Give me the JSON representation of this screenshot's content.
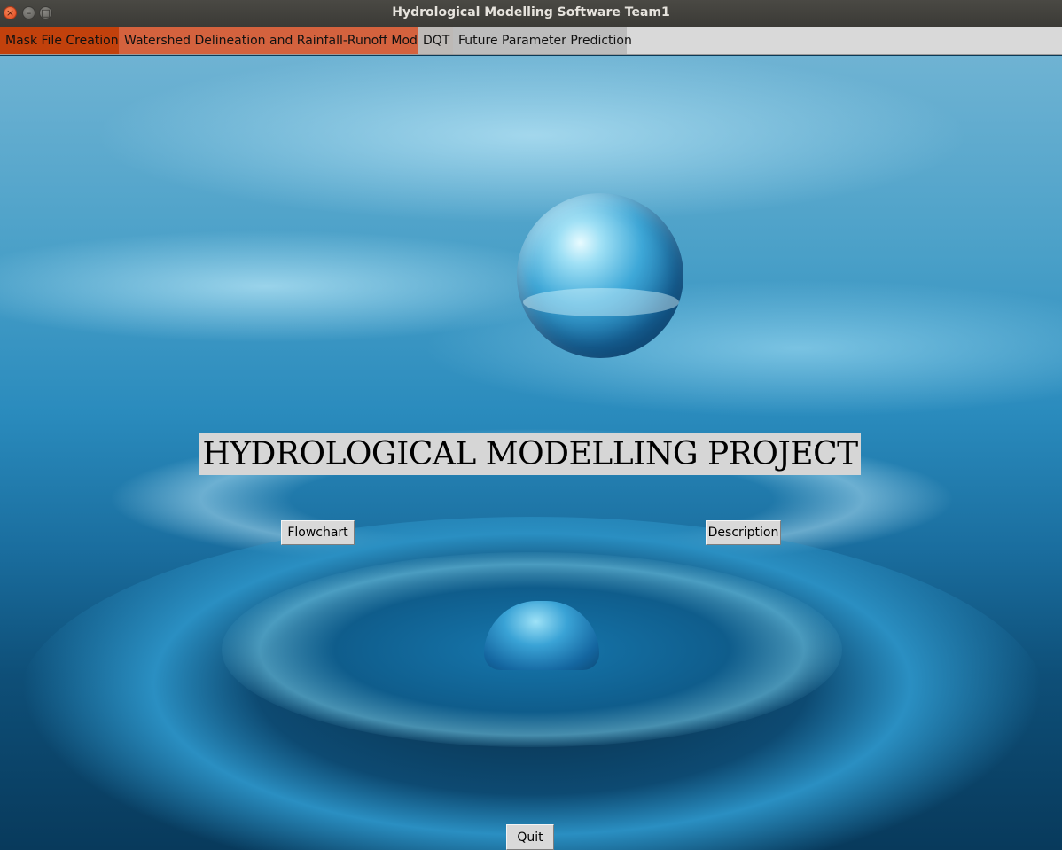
{
  "window": {
    "title": "Hydrological Modelling Software Team1",
    "controls": {
      "close_icon": "close-icon",
      "minimize_icon": "minimize-icon",
      "maximize_icon": "maximize-icon"
    }
  },
  "tabs": [
    {
      "label": "Mask File Creation",
      "color": "#c2410c"
    },
    {
      "label": "Watershed Delineation and Rainfall-Runoff Model",
      "color": "#d4623e"
    },
    {
      "label": "DQT",
      "color": "#bdb9b6"
    },
    {
      "label": "Future Parameter Prediction",
      "color": "#bcbcbc"
    }
  ],
  "main": {
    "heading": "HYDROLOGICAL MODELLING PROJECT",
    "buttons": {
      "flowchart": "Flowchart",
      "description": "Description",
      "quit": "Quit"
    }
  }
}
